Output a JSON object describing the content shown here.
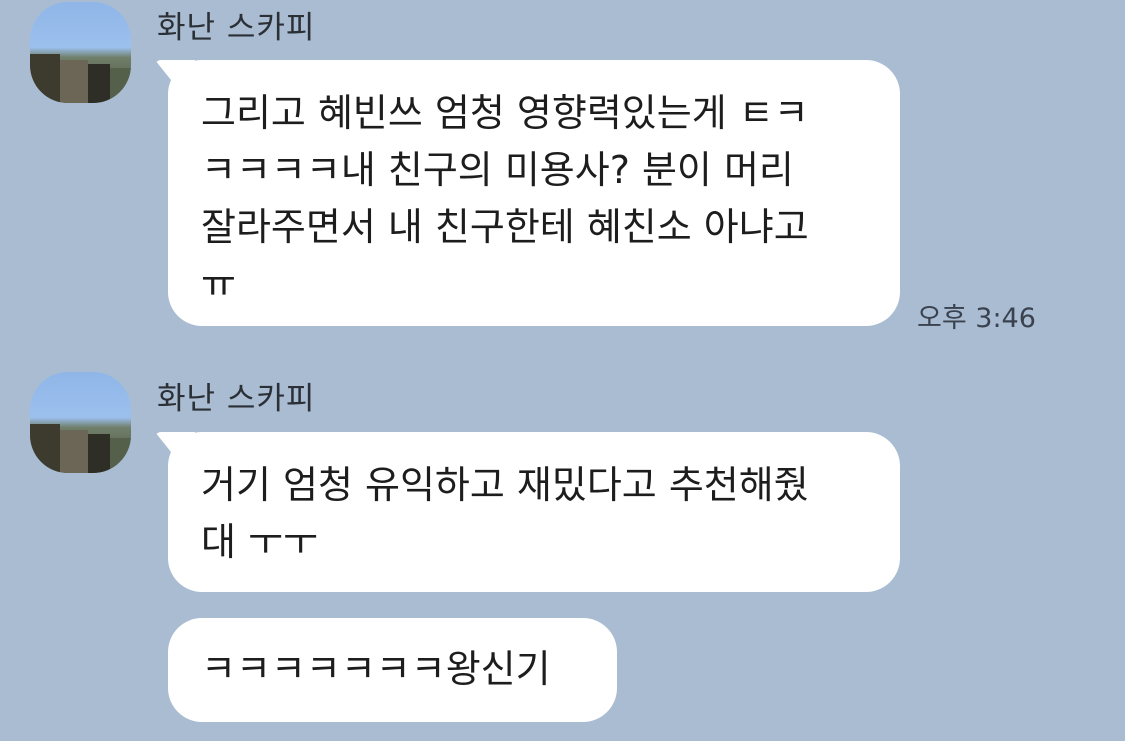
{
  "colors": {
    "background": "#a9bcd2",
    "bubble": "#ffffff",
    "text": "#1d1d1d"
  },
  "messages": [
    {
      "sender": "화난 스카피",
      "lines": [
        "그리고 혜빈쓰 엄청 영향력있는게 ㅌㅋ",
        "ㅋㅋㅋㅋ내 친구의 미용사? 분이 머리",
        "잘라주면서 내 친구한테 혜친소 아냐고",
        "ㅠ"
      ],
      "time": "오후 3:46"
    },
    {
      "sender": "화난 스카피",
      "lines": [
        "거기 엄청 유익하고 재밌다고 추천해줬",
        "대 ㅜㅜ"
      ]
    },
    {
      "lines": [
        "ㅋㅋㅋㅋㅋㅋㅋ왕신기"
      ]
    }
  ]
}
